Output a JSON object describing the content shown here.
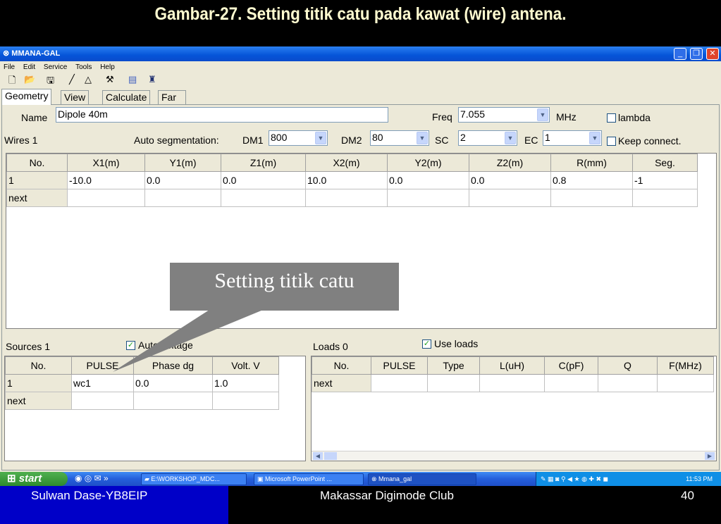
{
  "slide": {
    "title": "Gambar-27. Setting titik catu pada kawat (wire) antena.",
    "callout": "Setting titik catu",
    "footer_left": "Sulwan Dase-YB8EIP",
    "footer_center": "Makassar Digimode Club",
    "page_number": "40"
  },
  "window": {
    "title": "MMANA-GAL",
    "menu": [
      "File",
      "Edit",
      "Service",
      "Tools",
      "Help"
    ],
    "tabs": [
      "Geometry",
      "View",
      "Calculate",
      "Far field plots"
    ]
  },
  "geometry": {
    "name_label": "Name",
    "name_value": "Dipole 40m",
    "freq_label": "Freq",
    "freq_value": "7.055",
    "mhz_label": "MHz",
    "lambda_label": "lambda",
    "lambda_checked": false,
    "wires_label": "Wires 1",
    "auto_seg_label": "Auto segmentation:",
    "dm1_label": "DM1",
    "dm1_value": "800",
    "dm2_label": "DM2",
    "dm2_value": "80",
    "sc_label": "SC",
    "sc_value": "2",
    "ec_label": "EC",
    "ec_value": "1",
    "keep_connect_label": "Keep connect.",
    "keep_connect_checked": false
  },
  "wires_table": {
    "headers": [
      "No.",
      "X1(m)",
      "Y1(m)",
      "Z1(m)",
      "X2(m)",
      "Y2(m)",
      "Z2(m)",
      "R(mm)",
      "Seg."
    ],
    "rows": [
      [
        "1",
        "-10.0",
        "0.0",
        "0.0",
        "10.0",
        "0.0",
        "0.0",
        "0.8",
        "-1"
      ],
      [
        "next",
        "",
        "",
        "",
        "",
        "",
        "",
        "",
        ""
      ]
    ]
  },
  "sources": {
    "label": "Sources 1",
    "auto_voltage_label": "Auto voltage",
    "auto_voltage_checked": true,
    "headers": [
      "No.",
      "PULSE",
      "Phase dg",
      "Volt. V"
    ],
    "rows": [
      [
        "1",
        "wc1",
        "0.0",
        "1.0"
      ],
      [
        "next",
        "",
        "",
        ""
      ]
    ]
  },
  "loads": {
    "label": "Loads 0",
    "use_loads_label": "Use loads",
    "use_loads_checked": true,
    "headers": [
      "No.",
      "PULSE",
      "Type",
      "L(uH)",
      "C(pF)",
      "Q",
      "F(MHz)"
    ],
    "rows": [
      [
        "next",
        "",
        "",
        "",
        "",
        "",
        ""
      ]
    ]
  },
  "taskbar": {
    "start_label": "start",
    "tasks": [
      "E:\\WORKSHOP_MDC...",
      "Microsoft PowerPoint ...",
      "Mmana_gal"
    ],
    "clock": "11:53 PM"
  },
  "colors": {
    "title_text": "#fffbd0",
    "window_bg": "#ece9d8",
    "titlebar_blue": "#0554d8",
    "footer_blue": "#0000c8",
    "callout_gray": "#808080"
  }
}
